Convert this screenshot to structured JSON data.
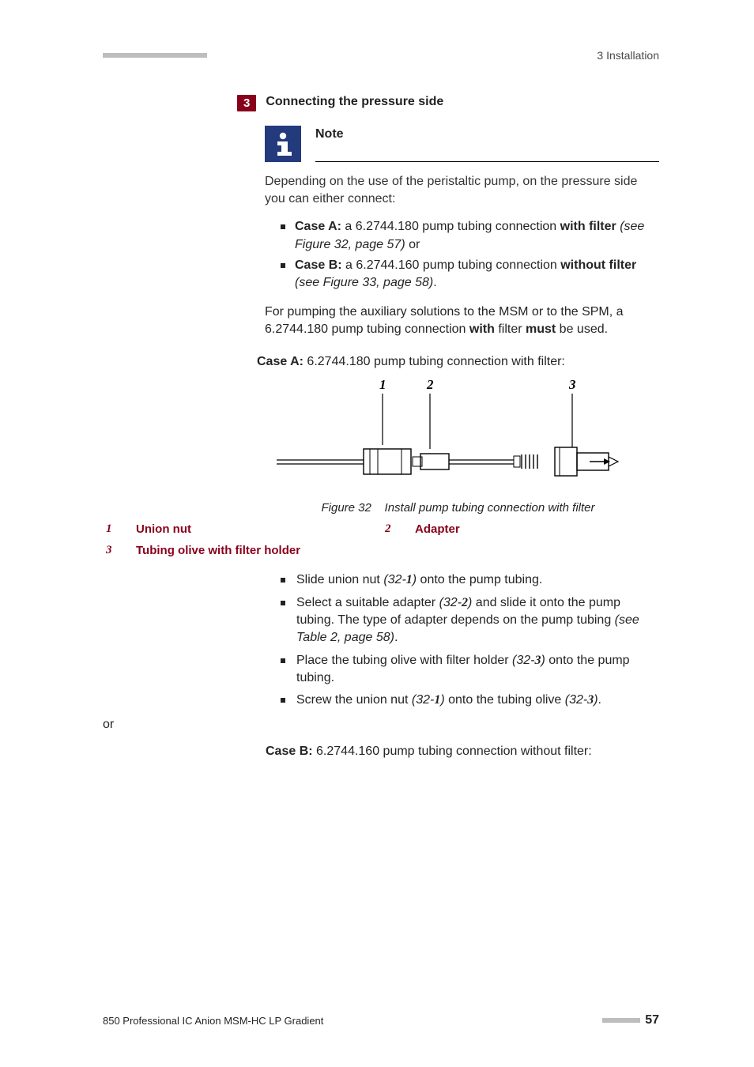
{
  "header": {
    "chapter": "3 Installation"
  },
  "step": {
    "number": "3",
    "title": "Connecting the pressure side"
  },
  "note": {
    "heading": "Note",
    "intro": "Depending on the use of the peristaltic pump, on the pressure side you can either connect:",
    "caseA_prefix": "Case A:",
    "caseA_text": " a 6.2744.180 pump tubing connection ",
    "caseA_bold": "with filter",
    "caseA_ref": "(see Figure 32, page 57)",
    "caseA_tail": " or",
    "caseB_prefix": "Case B:",
    "caseB_text": " a 6.2744.160 pump tubing connection ",
    "caseB_bold": "without filter",
    "caseB_ref": "(see Figure 33, page 58)",
    "caseB_tail": ".",
    "closing_a": "For pumping the auxiliary solutions to the MSM or to the SPM, a 6.2744.180 pump tubing connection ",
    "closing_b": "with",
    "closing_c": " filter ",
    "closing_d": "must",
    "closing_e": " be used."
  },
  "caseA": {
    "label": "Case A:",
    "text": " 6.2744.180 pump tubing connection with filter:"
  },
  "figure": {
    "n1": "1",
    "n2": "2",
    "n3": "3",
    "caption_prefix": "Figure 32",
    "caption_text": "Install pump tubing connection with filter"
  },
  "legend": {
    "n1": "1",
    "l1": "Union nut",
    "n2": "2",
    "l2": "Adapter",
    "n3": "3",
    "l3": "Tubing olive with filter holder"
  },
  "instructions": {
    "i1a": "Slide union nut ",
    "i1ref": "(32-",
    "i1b": "1",
    "i1c": ")",
    "i1d": " onto the pump tubing.",
    "i2a": "Select a suitable adapter ",
    "i2ref": "(32-",
    "i2b": "2",
    "i2c": ")",
    "i2d": " and slide it onto the pump tubing. The type of adapter depends on the pump tubing ",
    "i2e": "(see Table 2, page 58)",
    "i2f": ".",
    "i3a": "Place the tubing olive with filter holder ",
    "i3ref": "(32-",
    "i3b": "3",
    "i3c": ")",
    "i3d": " onto the pump tubing.",
    "i4a": "Screw the union nut ",
    "i4ref1": "(32-",
    "i4b": "1",
    "i4c": ")",
    "i4d": " onto the tubing olive ",
    "i4ref2": "(32-",
    "i4e": "3",
    "i4f": ")",
    "i4g": "."
  },
  "or_text": "or",
  "caseB": {
    "label": "Case B:",
    "text": " 6.2744.160 pump tubing connection without filter:"
  },
  "footer": {
    "product": "850 Professional IC Anion MSM-HC LP Gradient",
    "page": "57"
  }
}
